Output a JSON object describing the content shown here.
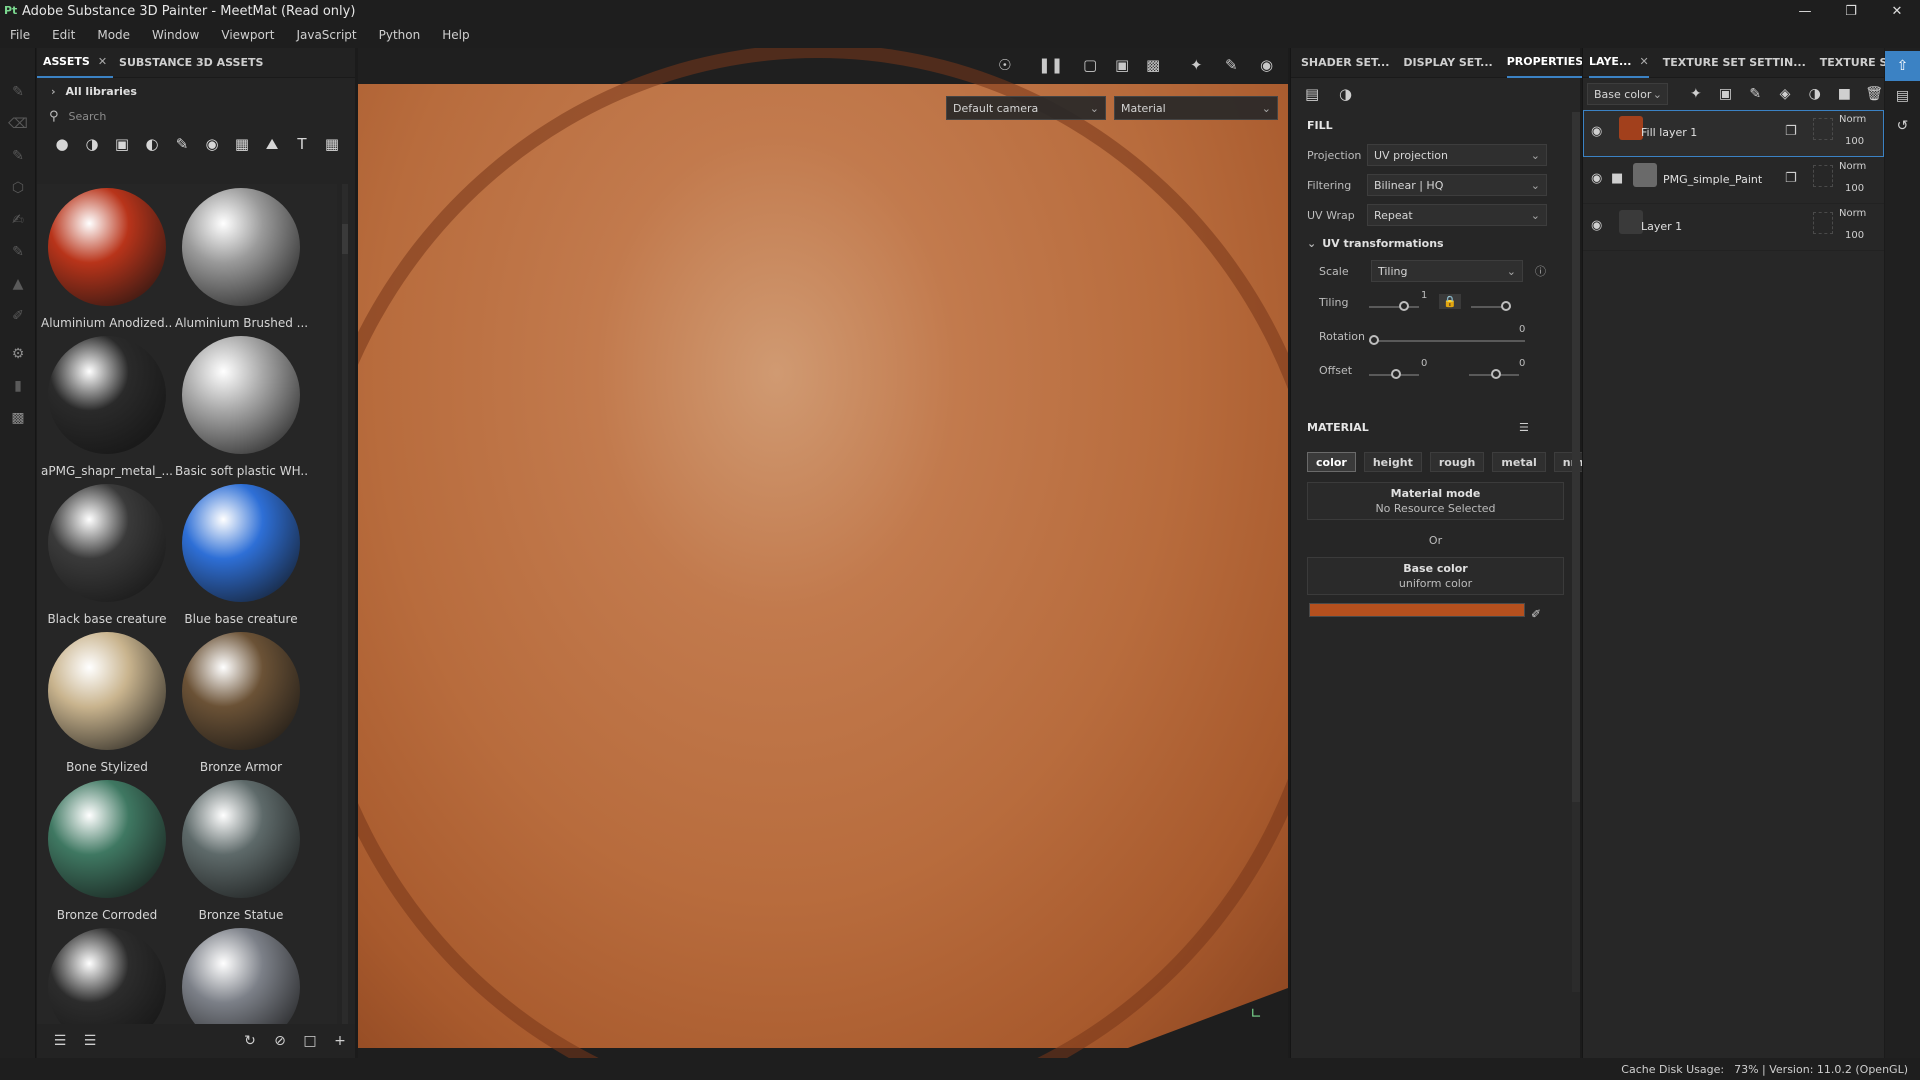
{
  "window": {
    "title": "Adobe Substance 3D Painter - MeetMat (Read only)",
    "app_icon": "Pt"
  },
  "menu": [
    "File",
    "Edit",
    "Mode",
    "Window",
    "Viewport",
    "JavaScript",
    "Python",
    "Help"
  ],
  "assets_panel": {
    "tabs": [
      {
        "label": "ASSETS",
        "active": true
      },
      {
        "label": "SUBSTANCE 3D ASSETS",
        "active": false
      }
    ],
    "libraries_label": "All libraries",
    "search_placeholder": "Search",
    "items": [
      {
        "label": "Aluminium Anodized...",
        "color": "#b8341a"
      },
      {
        "label": "Aluminium Brushed ...",
        "color": "#9a9a9a"
      },
      {
        "label": "aPMG_shapr_metal_...",
        "color": "#2a2a2a"
      },
      {
        "label": "Basic soft plastic WH...",
        "color": "#a8a8a8"
      },
      {
        "label": "Black base creature",
        "color": "#3a3a3a"
      },
      {
        "label": "Blue base creature",
        "color": "#2e6fd6"
      },
      {
        "label": "Bone Stylized",
        "color": "#c9b48e"
      },
      {
        "label": "Bronze Armor",
        "color": "#6b5236"
      },
      {
        "label": "Bronze Corroded",
        "color": "#3f7862"
      },
      {
        "label": "Bronze Statue",
        "color": "#5e6a6a"
      },
      {
        "label": "",
        "color": "#2c2c2c"
      },
      {
        "label": "",
        "color": "#7c8088"
      }
    ]
  },
  "viewport": {
    "camera_select": "Default camera",
    "mode_select": "Material"
  },
  "properties_panel": {
    "tabs": [
      {
        "label": "SHADER SET...",
        "active": false
      },
      {
        "label": "DISPLAY SET...",
        "active": false
      },
      {
        "label": "PROPERTIES ...",
        "active": true
      }
    ],
    "fill_title": "FILL",
    "projection_label": "Projection",
    "projection_value": "UV projection",
    "filtering_label": "Filtering",
    "filtering_value": "Bilinear | HQ",
    "uvwrap_label": "UV Wrap",
    "uvwrap_value": "Repeat",
    "uv_transformations_title": "UV transformations",
    "scale_label": "Scale",
    "scale_value": "Tiling",
    "tiling_label": "Tiling",
    "tiling_value": "1",
    "rotation_label": "Rotation",
    "rotation_value": "0",
    "offset_label": "Offset",
    "offset_u": "0",
    "offset_v": "0",
    "material_title": "MATERIAL",
    "material_channels": [
      {
        "label": "color",
        "active": true
      },
      {
        "label": "height",
        "active": false
      },
      {
        "label": "rough",
        "active": false
      },
      {
        "label": "metal",
        "active": false
      },
      {
        "label": "nrm",
        "active": false
      }
    ],
    "material_mode_title": "Material mode",
    "material_mode_value": "No Resource Selected",
    "or_label": "Or",
    "base_color_title": "Base color",
    "base_color_value": "uniform color",
    "base_color_swatch": "#b5501e"
  },
  "layers_panel": {
    "tabs": [
      {
        "label": "LAYE...",
        "active": true
      },
      {
        "label": "TEXTURE SET SETTIN...",
        "active": false
      },
      {
        "label": "TEXTURE SET LI...",
        "active": false
      }
    ],
    "channel_select": "Base color",
    "layers": [
      {
        "name": "Fill layer 1",
        "blend": "Norm",
        "opacity": "100",
        "thumb": "#a2401c",
        "selected": true,
        "folder": false
      },
      {
        "name": "PMG_simple_Paint",
        "blend": "Norm",
        "opacity": "100",
        "thumb": "#6a6a6a",
        "selected": false,
        "folder": true
      },
      {
        "name": "Layer 1",
        "blend": "Norm",
        "opacity": "100",
        "thumb": "#3a3a3a",
        "selected": false,
        "folder": false
      }
    ]
  },
  "status": {
    "cache_label": "Cache Disk Usage:",
    "cache_value": "73% | Version: 11.0.2 (OpenGL)"
  },
  "colors": {
    "accent": "#3b82c4",
    "viewport_surface": "#b86c3d"
  }
}
